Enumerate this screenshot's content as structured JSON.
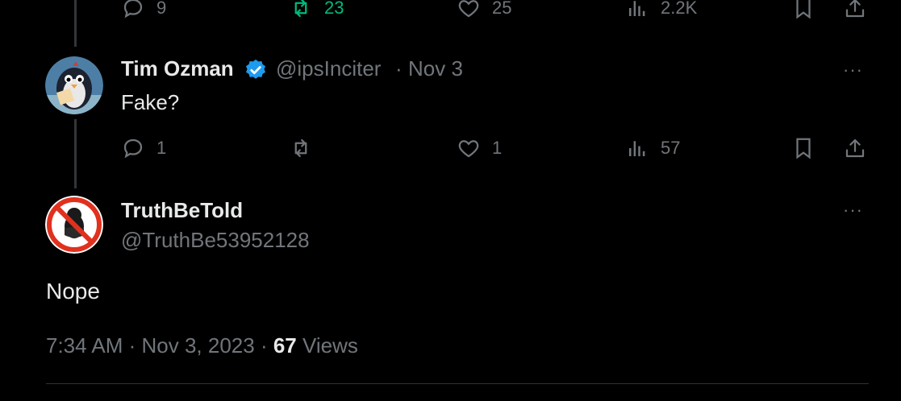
{
  "top_actions": {
    "replies": "9",
    "reposts": "23",
    "likes": "25",
    "views": "2.2K"
  },
  "reply_tweet": {
    "name": "Tim Ozman",
    "handle": "@ipsInciter",
    "separator": "·",
    "date": "Nov 3",
    "text": "Fake?",
    "more": "···",
    "actions": {
      "replies": "1",
      "reposts": "",
      "likes": "1",
      "views": "57"
    }
  },
  "main_tweet": {
    "name": "TruthBeTold",
    "handle": "@TruthBe53952128",
    "more": "···",
    "text": "Nope",
    "time": "7:34 AM",
    "sep1": " · ",
    "date": "Nov 3, 2023",
    "sep2": " · ",
    "views_count": "67",
    "views_label": " Views"
  },
  "colors": {
    "background": "#000000",
    "primary_text": "#e7e9ea",
    "secondary_text": "#71767b",
    "repost_active": "#00ba7c",
    "verified_blue": "#1d9bf0",
    "divider": "#2f3336"
  },
  "icons": [
    "reply-icon",
    "repost-icon",
    "like-icon",
    "views-icon",
    "bookmark-icon",
    "share-icon",
    "verified-badge-icon",
    "more-icon"
  ]
}
